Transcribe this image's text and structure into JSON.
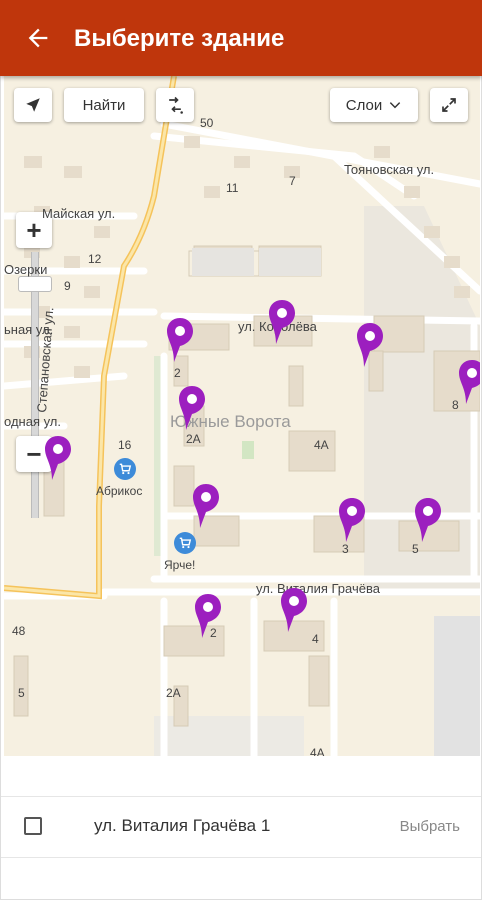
{
  "header": {
    "title": "Выберите здание",
    "back_icon": "arrow-back-icon",
    "bg": "#bf360c"
  },
  "map": {
    "controls": {
      "geolocate_icon": "navigation-arrow-icon",
      "find_label": "Найти",
      "route_icon": "route-icon",
      "layers_label": "Слои",
      "fullscreen_icon": "expand-icon",
      "zoom_in": "+",
      "zoom_out": "−"
    },
    "district": "Южные Ворота",
    "streets": [
      "Майская ул.",
      "Озерки",
      "ул. Королёва",
      "Тояновская ул.",
      "Степановская ул.",
      "ул. Виталия Грачёва",
      "одная ул.",
      "ьная ул."
    ],
    "house_numbers": [
      "50",
      "11",
      "7",
      "12",
      "9",
      "16",
      "2",
      "2А",
      "4А",
      "8",
      "3",
      "5",
      "2",
      "4",
      "2А",
      "4А",
      "48",
      "5"
    ],
    "shops": [
      "Абрикос",
      "Ярче!"
    ],
    "pin_color": "#9c1fbf"
  },
  "selection": {
    "address": "ул. Виталия Грачёва 1",
    "checked": false,
    "action_label": "Выбрать"
  }
}
